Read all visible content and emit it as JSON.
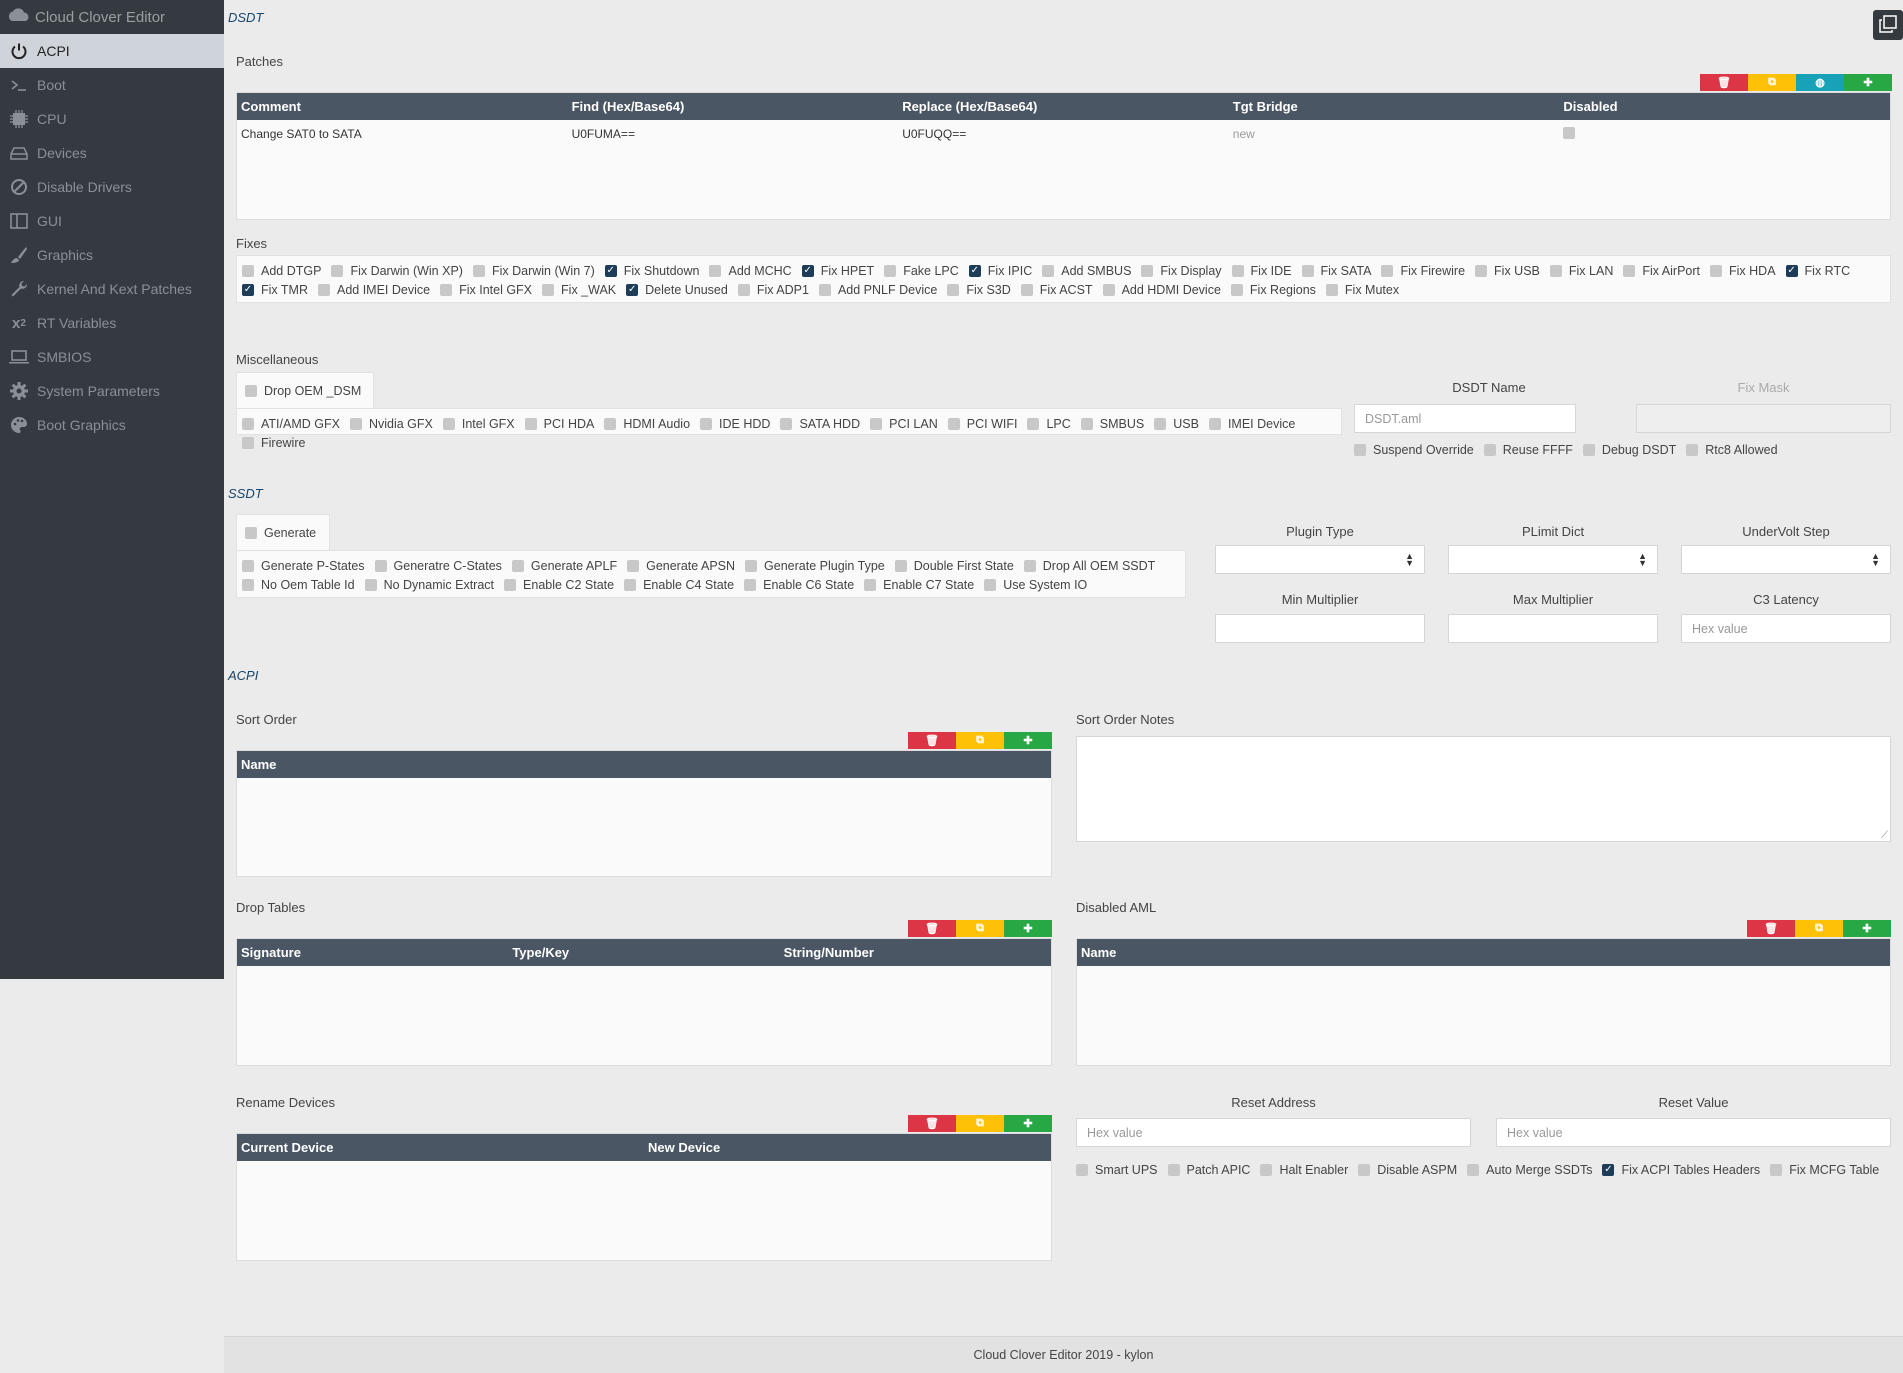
{
  "app": {
    "title": "Cloud Clover Editor"
  },
  "sidebar": {
    "items": [
      {
        "label": "ACPI",
        "active": true
      },
      {
        "label": "Boot"
      },
      {
        "label": "CPU"
      },
      {
        "label": "Devices"
      },
      {
        "label": "Disable Drivers"
      },
      {
        "label": "GUI"
      },
      {
        "label": "Graphics"
      },
      {
        "label": "Kernel And Kext Patches"
      },
      {
        "label": "RT Variables"
      },
      {
        "label": "SMBIOS"
      },
      {
        "label": "System Parameters"
      },
      {
        "label": "Boot Graphics"
      }
    ]
  },
  "dsdt": {
    "title": "DSDT",
    "patches": {
      "label": "Patches",
      "columns": [
        "Comment",
        "Find (Hex/Base64)",
        "Replace (Hex/Base64)",
        "Tgt Bridge",
        "Disabled"
      ],
      "rows": [
        {
          "comment": "Change SAT0 to SATA",
          "find": "U0FUMA==",
          "replace": "U0FUQQ==",
          "tgt_bridge": "new",
          "disabled": false
        }
      ]
    },
    "fixes": {
      "label": "Fixes",
      "items": [
        {
          "label": "Add DTGP",
          "checked": false
        },
        {
          "label": "Fix Darwin (Win XP)",
          "checked": false
        },
        {
          "label": "Fix Darwin (Win 7)",
          "checked": false
        },
        {
          "label": "Fix Shutdown",
          "checked": true
        },
        {
          "label": "Add MCHC",
          "checked": false
        },
        {
          "label": "Fix HPET",
          "checked": true
        },
        {
          "label": "Fake LPC",
          "checked": false
        },
        {
          "label": "Fix IPIC",
          "checked": true
        },
        {
          "label": "Add SMBUS",
          "checked": false
        },
        {
          "label": "Fix Display",
          "checked": false
        },
        {
          "label": "Fix IDE",
          "checked": false
        },
        {
          "label": "Fix SATA",
          "checked": false
        },
        {
          "label": "Fix Firewire",
          "checked": false
        },
        {
          "label": "Fix USB",
          "checked": false
        },
        {
          "label": "Fix LAN",
          "checked": false
        },
        {
          "label": "Fix AirPort",
          "checked": false
        },
        {
          "label": "Fix HDA",
          "checked": false
        },
        {
          "label": "Fix RTC",
          "checked": true
        },
        {
          "label": "Fix TMR",
          "checked": true
        },
        {
          "label": "Add IMEI Device",
          "checked": false
        },
        {
          "label": "Fix Intel GFX",
          "checked": false
        },
        {
          "label": "Fix _WAK",
          "checked": false
        },
        {
          "label": "Delete Unused",
          "checked": true
        },
        {
          "label": "Fix ADP1",
          "checked": false
        },
        {
          "label": "Add PNLF Device",
          "checked": false
        },
        {
          "label": "Fix S3D",
          "checked": false
        },
        {
          "label": "Fix ACST",
          "checked": false
        },
        {
          "label": "Add HDMI Device",
          "checked": false
        },
        {
          "label": "Fix Regions",
          "checked": false
        },
        {
          "label": "Fix Mutex",
          "checked": false
        }
      ]
    },
    "misc": {
      "label": "Miscellaneous",
      "drop_oem_dsm": {
        "label": "Drop OEM _DSM",
        "checked": false
      },
      "items": [
        {
          "label": "ATI/AMD GFX",
          "checked": false
        },
        {
          "label": "Nvidia GFX",
          "checked": false
        },
        {
          "label": "Intel GFX",
          "checked": false
        },
        {
          "label": "PCI HDA",
          "checked": false
        },
        {
          "label": "HDMI Audio",
          "checked": false
        },
        {
          "label": "IDE HDD",
          "checked": false
        },
        {
          "label": "SATA HDD",
          "checked": false
        },
        {
          "label": "PCI LAN",
          "checked": false
        },
        {
          "label": "PCI WIFI",
          "checked": false
        },
        {
          "label": "LPC",
          "checked": false
        },
        {
          "label": "SMBUS",
          "checked": false
        },
        {
          "label": "USB",
          "checked": false
        },
        {
          "label": "IMEI Device",
          "checked": false
        },
        {
          "label": "Firewire",
          "checked": false
        }
      ]
    },
    "dsdt_name": {
      "label": "DSDT Name",
      "value": "DSDT.aml"
    },
    "fix_mask": {
      "label": "Fix Mask",
      "value": ""
    },
    "options": [
      {
        "label": "Suspend Override",
        "checked": false
      },
      {
        "label": "Reuse FFFF",
        "checked": false
      },
      {
        "label": "Debug DSDT",
        "checked": false
      },
      {
        "label": "Rtc8 Allowed",
        "checked": false
      }
    ]
  },
  "ssdt": {
    "title": "SSDT",
    "generate": {
      "label": "Generate",
      "checked": false
    },
    "items": [
      {
        "label": "Generate P-States",
        "checked": false
      },
      {
        "label": "Generatre C-States",
        "checked": false
      },
      {
        "label": "Generate APLF",
        "checked": false
      },
      {
        "label": "Generate APSN",
        "checked": false
      },
      {
        "label": "Generate Plugin Type",
        "checked": false
      },
      {
        "label": "Double First State",
        "checked": false
      },
      {
        "label": "Drop All OEM SSDT",
        "checked": false
      },
      {
        "label": "No Oem Table Id",
        "checked": false
      },
      {
        "label": "No Dynamic Extract",
        "checked": false
      },
      {
        "label": "Enable C2 State",
        "checked": false
      },
      {
        "label": "Enable C4 State",
        "checked": false
      },
      {
        "label": "Enable C6 State",
        "checked": false
      },
      {
        "label": "Enable C7 State",
        "checked": false
      },
      {
        "label": "Use System IO",
        "checked": false
      }
    ],
    "plugin_type": {
      "label": "Plugin Type",
      "value": ""
    },
    "plimit_dict": {
      "label": "PLimit Dict",
      "value": ""
    },
    "undervolt_step": {
      "label": "UnderVolt Step",
      "value": ""
    },
    "min_multiplier": {
      "label": "Min Multiplier",
      "value": ""
    },
    "max_multiplier": {
      "label": "Max Multiplier",
      "value": ""
    },
    "c3_latency": {
      "label": "C3 Latency",
      "placeholder": "Hex value"
    }
  },
  "acpi": {
    "title": "ACPI",
    "sort_order": {
      "label": "Sort Order",
      "columns": [
        "Name"
      ]
    },
    "sort_order_notes": {
      "label": "Sort Order Notes"
    },
    "drop_tables": {
      "label": "Drop Tables",
      "columns": [
        "Signature",
        "Type/Key",
        "String/Number"
      ]
    },
    "disabled_aml": {
      "label": "Disabled AML",
      "columns": [
        "Name"
      ]
    },
    "rename_devices": {
      "label": "Rename Devices",
      "columns": [
        "Current Device",
        "New Device"
      ]
    },
    "reset_address": {
      "label": "Reset Address",
      "placeholder": "Hex value"
    },
    "reset_value": {
      "label": "Reset Value",
      "placeholder": "Hex value"
    },
    "options": [
      {
        "label": "Smart UPS",
        "checked": false
      },
      {
        "label": "Patch APIC",
        "checked": false
      },
      {
        "label": "Halt Enabler",
        "checked": false
      },
      {
        "label": "Disable ASPM",
        "checked": false
      },
      {
        "label": "Auto Merge SSDTs",
        "checked": false
      },
      {
        "label": "Fix ACPI Tables Headers",
        "checked": true
      },
      {
        "label": "Fix MCFG Table",
        "checked": false
      }
    ]
  },
  "footer": {
    "text": "Cloud Clover Editor 2019 - kylon"
  },
  "colors": {
    "sidebar": "#343a40",
    "table_header": "#4a5663",
    "danger": "#dc3545",
    "warning": "#ffc107",
    "info": "#17a2b8",
    "success": "#28a745",
    "checked": "#1c3c57"
  }
}
